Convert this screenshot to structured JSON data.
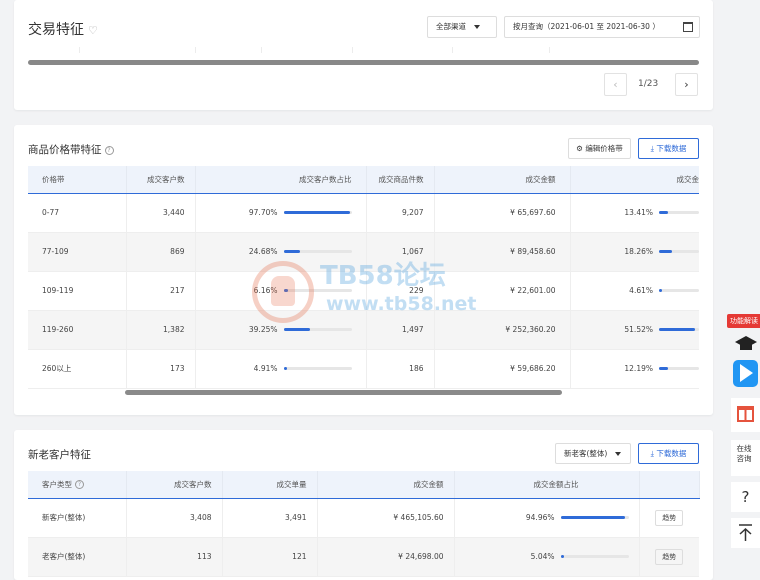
{
  "card1": {
    "title": "交易特征",
    "channel": "全部渠道",
    "date_range": "按月查询（2021-06-01 至 2021-06-30 ）",
    "pager": {
      "prev": "‹",
      "text": "1/23",
      "next": "›"
    }
  },
  "price_band": {
    "title": "商品价格带特征",
    "help": "?",
    "edit_button": "编辑价格带",
    "download_button": "下载数据",
    "columns": [
      "价格带",
      "成交客户数",
      "成交客户数占比",
      "成交商品件数",
      "成交金额",
      "成交金"
    ],
    "rows": [
      {
        "band": "0-77",
        "customers": "3,440",
        "share": "97.70%",
        "share_value": 97.7,
        "items": "9,207",
        "amount": "¥ 65,697.60",
        "amount_share": "13.41%",
        "amount_share_value": 13.41
      },
      {
        "band": "77-109",
        "customers": "869",
        "share": "24.68%",
        "share_value": 24.68,
        "items": "1,067",
        "amount": "¥ 89,458.60",
        "amount_share": "18.26%",
        "amount_share_value": 18.26
      },
      {
        "band": "109-119",
        "customers": "217",
        "share": "6.16%",
        "share_value": 6.16,
        "items": "229",
        "amount": "¥ 22,601.00",
        "amount_share": "4.61%",
        "amount_share_value": 4.61
      },
      {
        "band": "119-260",
        "customers": "1,382",
        "share": "39.25%",
        "share_value": 39.25,
        "items": "1,497",
        "amount": "¥ 252,360.20",
        "amount_share": "51.52%",
        "amount_share_value": 51.52
      },
      {
        "band": "260以上",
        "customers": "173",
        "share": "4.91%",
        "share_value": 4.91,
        "items": "186",
        "amount": "¥ 59,686.20",
        "amount_share": "12.19%",
        "amount_share_value": 12.19
      }
    ]
  },
  "watermark": {
    "line1": "TB58论坛",
    "line2": "www.tb58.net"
  },
  "customers": {
    "title": "新老客户特征",
    "filter": "新老客(整体)",
    "download_button": "下载数据",
    "columns": [
      "客户类型",
      "成交客户数",
      "成交单量",
      "成交金额",
      "成交金额占比",
      ""
    ],
    "type_help": "?",
    "rows": [
      {
        "type": "新客户(整体)",
        "customers": "3,408",
        "orders": "3,491",
        "amount": "¥ 465,105.60",
        "share": "94.96%",
        "share_value": 94.96,
        "action": "趋势"
      },
      {
        "type": "老客户(整体)",
        "customers": "113",
        "orders": "121",
        "amount": "¥ 24,698.00",
        "share": "5.04%",
        "share_value": 5.04,
        "action": "趋势"
      }
    ]
  },
  "sidebar": {
    "badge": "功能解读",
    "online": "在线咨询",
    "help": "?",
    "top": "⊼"
  },
  "colors": {
    "accent": "#2f6bd8",
    "badge": "#e53935",
    "gift": "#e5533d"
  }
}
